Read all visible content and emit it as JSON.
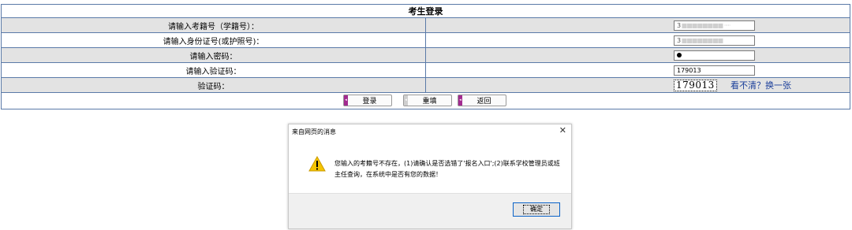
{
  "form": {
    "title": "考生登录",
    "rows": [
      {
        "label": "请输入考籍号（学籍号）：",
        "value_first": "3",
        "value_rest": "■■■■■■■■ ·····"
      },
      {
        "label": "请输入身份证号(或护照号)：",
        "value_first": "3",
        "value_rest": "■■■■■■■■"
      },
      {
        "label": "请输入密码："
      },
      {
        "label": "请输入验证码：",
        "value": "179013"
      },
      {
        "label": "验证码："
      }
    ],
    "captcha_text": "179013",
    "refresh_link": "看不清？换一张"
  },
  "buttons": {
    "login": "登录",
    "reset": "重填",
    "back": "返回"
  },
  "dialog": {
    "title": "来自网页的消息",
    "close_glyph": "✕",
    "message": "您输入的考籍号不存在，(1)请确认是否选错了'报名入口';(2)联系学校管理员或班主任查询，在系统中是否有您的数据！",
    "ok_label": "确定"
  },
  "colors": {
    "border": "#5a7aa8",
    "shade_row": "#e3e3e3",
    "link": "#1a3e9a",
    "button_icon": "#a22a8f",
    "warning": "#f5c400"
  }
}
